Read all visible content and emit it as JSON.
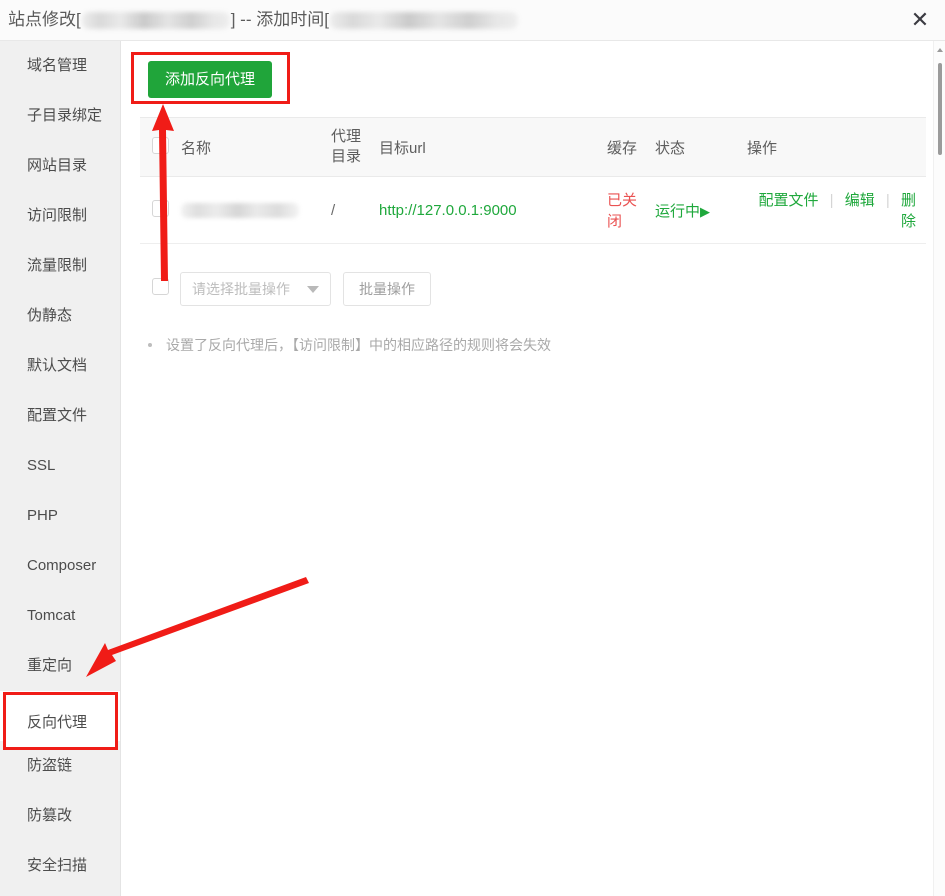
{
  "window": {
    "title_prefix": "站点修改[",
    "title_middle": "] -- 添加时间[",
    "title_suffix": "]",
    "close_icon": "close-icon"
  },
  "sidebar": {
    "items": [
      {
        "label": "域名管理",
        "active": false
      },
      {
        "label": "子目录绑定",
        "active": false
      },
      {
        "label": "网站目录",
        "active": false
      },
      {
        "label": "访问限制",
        "active": false
      },
      {
        "label": "流量限制",
        "active": false
      },
      {
        "label": "伪静态",
        "active": false
      },
      {
        "label": "默认文档",
        "active": false
      },
      {
        "label": "配置文件",
        "active": false
      },
      {
        "label": "SSL",
        "active": false
      },
      {
        "label": "PHP",
        "active": false
      },
      {
        "label": "Composer",
        "active": false
      },
      {
        "label": "Tomcat",
        "active": false
      },
      {
        "label": "重定向",
        "active": false
      },
      {
        "label": "反向代理",
        "active": true
      },
      {
        "label": "防盗链",
        "active": false
      },
      {
        "label": "防篡改",
        "active": false
      },
      {
        "label": "安全扫描",
        "active": false
      }
    ]
  },
  "toolbar": {
    "add_proxy_label": "添加反向代理"
  },
  "table": {
    "headers": {
      "name": "名称",
      "dir_line1": "代理",
      "dir_line2": "目录",
      "target_url": "目标url",
      "cache": "缓存",
      "status": "状态",
      "actions": "操作"
    },
    "rows": [
      {
        "name": "",
        "proxy_dir": "/",
        "target_url": "http://127.0.0.1:9000",
        "cache": "已关闭",
        "status": "运行中",
        "status_play_icon": "▶",
        "action_config": "配置文件",
        "action_edit": "编辑",
        "action_delete": "删除",
        "separator": "|"
      }
    ]
  },
  "batch": {
    "select_placeholder": "请选择批量操作",
    "button_label": "批量操作",
    "caret_icon": "chevron-down-icon"
  },
  "note": {
    "text": "设置了反向代理后，【访问限制】中的相应路径的规则将会失效"
  },
  "colors": {
    "green": "#20a53a",
    "link_green": "#1fa83c",
    "red_text": "#ea5252",
    "annotation_red": "#f01c17",
    "sidebar_bg": "#f0f0f0",
    "header_bg": "#f8f8f8"
  }
}
